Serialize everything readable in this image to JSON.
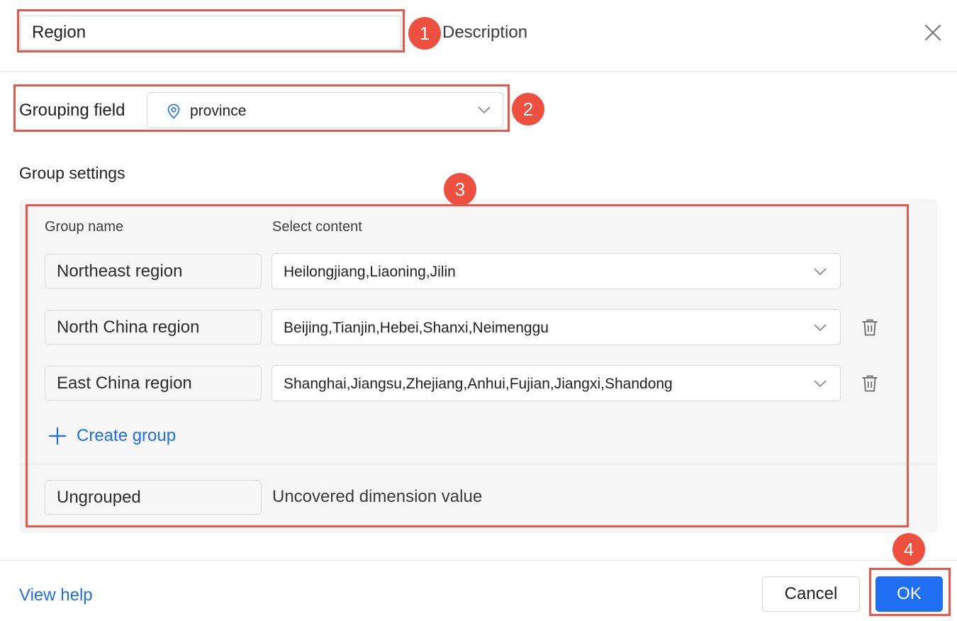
{
  "header": {
    "name_value": "Region",
    "description_label": "Description",
    "close_icon": "close-icon"
  },
  "grouping_field": {
    "label": "Grouping field",
    "icon": "location-pin-icon",
    "value": "province"
  },
  "group_settings": {
    "title": "Group settings",
    "col_group_name": "Group name",
    "col_select_content": "Select content",
    "groups": [
      {
        "name": "Northeast region",
        "content": "Heilongjiang,Liaoning,Jilin",
        "deletable": false
      },
      {
        "name": "North China region",
        "content": "Beijing,Tianjin,Hebei,Shanxi,Neimenggu",
        "deletable": true
      },
      {
        "name": "East China region",
        "content": "Shanghai,Jiangsu,Zhejiang,Anhui,Fujian,Jiangxi,Shandong",
        "deletable": true
      }
    ],
    "create_group_label": "Create group",
    "ungrouped_name": "Ungrouped",
    "ungrouped_description": "Uncovered dimension value"
  },
  "footer": {
    "help_label": "View help",
    "cancel_label": "Cancel",
    "ok_label": "OK"
  },
  "annotations": [
    "1",
    "2",
    "3",
    "4"
  ],
  "colors": {
    "primary": "#1f6ff5",
    "link": "#1e6fe8",
    "annotation": "#ef4f3f",
    "annotation_border": "#e8574a",
    "panel_bg": "#f6f6f6"
  }
}
